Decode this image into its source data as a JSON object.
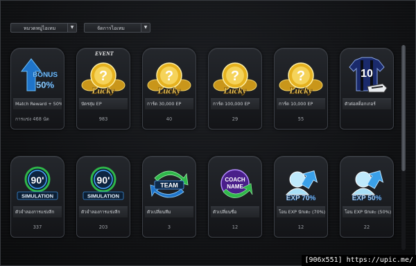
{
  "filters": {
    "category": "หมวดหมู่ไอเทม",
    "sort": "จัดการไอเทม"
  },
  "event_badge": "EVENT",
  "cards": [
    {
      "label": "Match Reward + 50%",
      "count": "การแข่ง 468 นัด",
      "icon": "bonus-50-arrow-icon",
      "icon_text": "BONUS",
      "icon_value": "50%"
    },
    {
      "label": "บัตรสุ่ม EP",
      "count": "983",
      "icon": "lucky-ep-coin-icon",
      "icon_text": "Lucky"
    },
    {
      "label": "การ์ด 30,000 EP",
      "count": "40",
      "icon": "lucky-ep-coin-icon",
      "icon_text": "Lucky"
    },
    {
      "label": "การ์ด 100,000 EP",
      "count": "29",
      "icon": "lucky-ep-coin-icon",
      "icon_text": "Lucky"
    },
    {
      "label": "การ์ด 10,000 EP",
      "count": "55",
      "icon": "lucky-ep-coin-icon",
      "icon_text": "Lucky"
    },
    {
      "label": "ตัวต่อสต็อกเกอร์",
      "count": "",
      "icon": "jersey-10-boot-icon",
      "icon_text": "10"
    },
    {
      "label": "ตัวจำลองการแข่งลีก",
      "count": "337",
      "icon": "simulation-90-icon",
      "icon_text": "90'",
      "icon_value": "SIMULATION"
    },
    {
      "label": "ตัวจำลองการแข่งลีก",
      "count": "203",
      "icon": "simulation-90-icon",
      "icon_text": "90'",
      "icon_value": "SIMULATION"
    },
    {
      "label": "ตัวเปลี่ยนทีม",
      "count": "3",
      "icon": "team-change-icon",
      "icon_text": "TEAM"
    },
    {
      "label": "ตัวเปลี่ยนชื่อ",
      "count": "12",
      "icon": "coach-name-icon",
      "icon_text": "COACH",
      "icon_value": "NAME"
    },
    {
      "label": "โอน EXP นักเตะ (70%)",
      "count": "12",
      "icon": "exp-70-transfer-icon",
      "icon_text": "EXP 70%"
    },
    {
      "label": "โอน EXP นักเตะ (50%)",
      "count": "22",
      "icon": "exp-50-transfer-icon",
      "icon_text": "EXP 50%"
    }
  ],
  "watermark": "[906x551] https://upic.me/",
  "colors": {
    "gold": "#e6b21f",
    "blue": "#2a8fe0",
    "green": "#2fb84a",
    "purple": "#7a3fd0",
    "ice": "#8fd4f2"
  }
}
